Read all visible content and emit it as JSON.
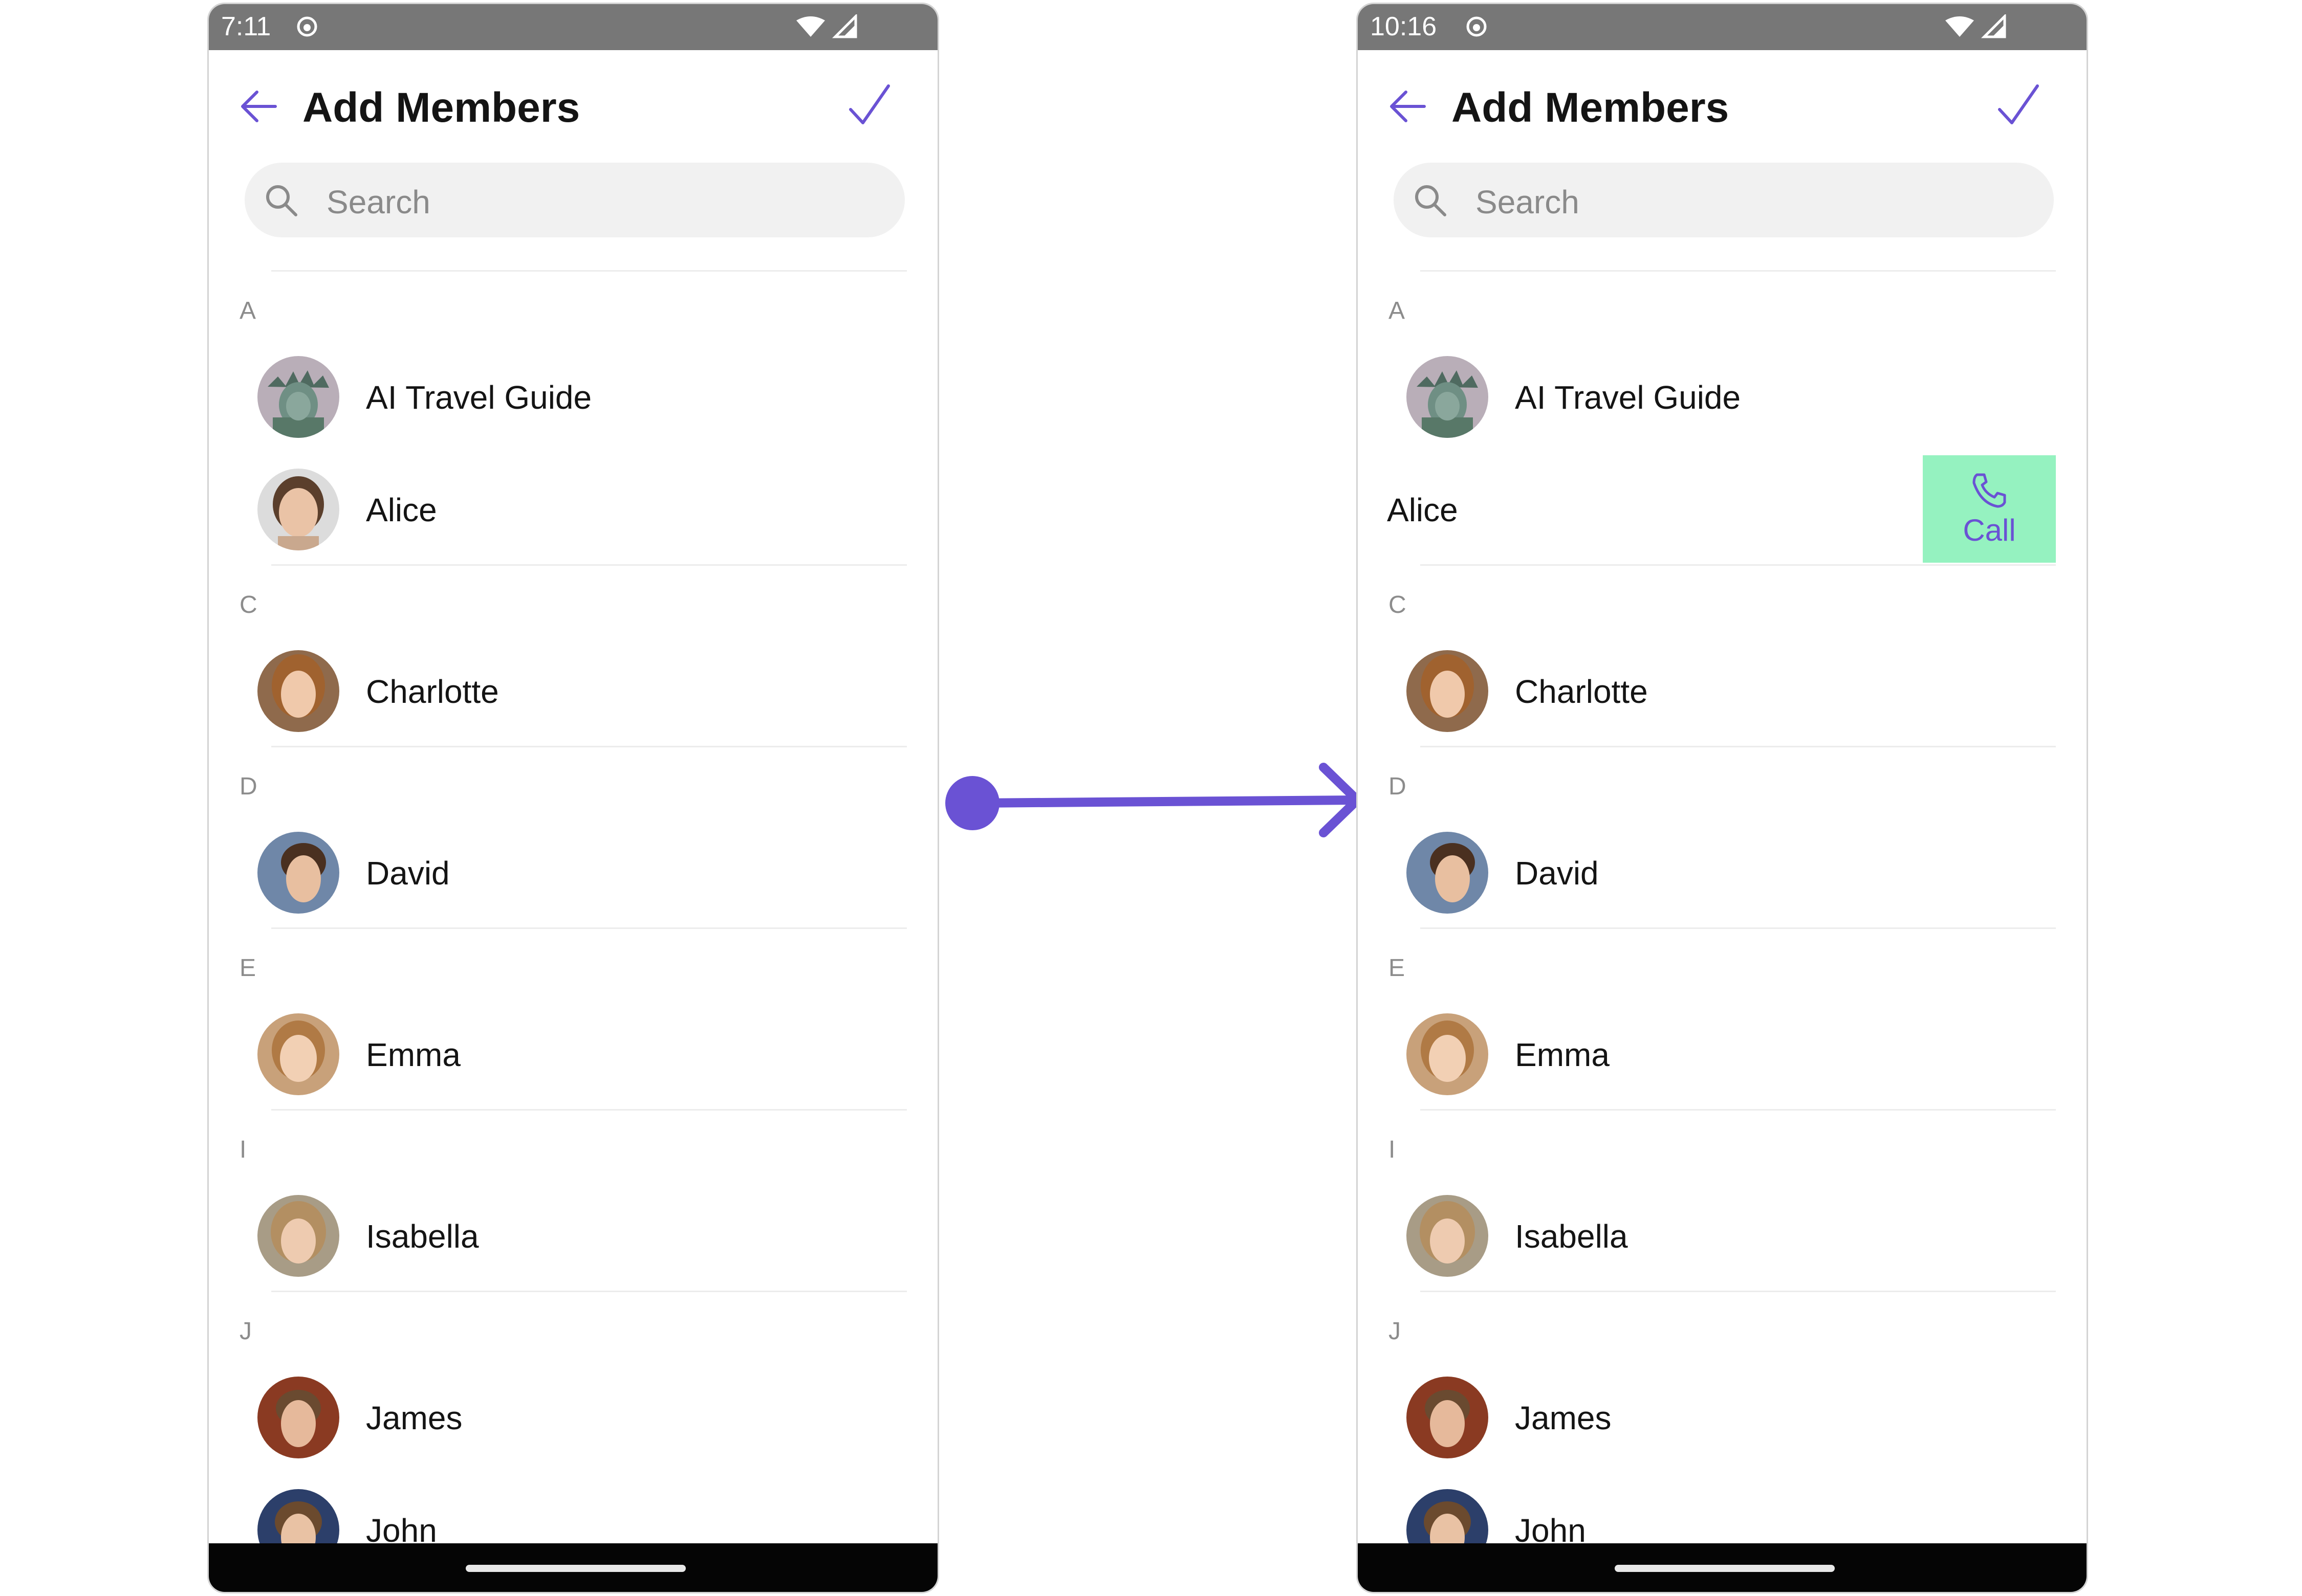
{
  "colors": {
    "accent": "#6a52d4",
    "status_bar": "#777777",
    "call_action_bg": "#95f2c0",
    "nav_bar": "#050505",
    "text_primary": "#141414",
    "text_secondary": "#8c8c8c",
    "search_bg": "#f1f1f1"
  },
  "before": {
    "status": {
      "time": "7:11",
      "icons": [
        "app-notification-icon",
        "wifi-icon",
        "signal-icon"
      ]
    },
    "header": {
      "title": "Add Members",
      "back_icon": "arrow-left-icon",
      "confirm_icon": "checkmark-icon"
    },
    "search": {
      "placeholder": "Search",
      "icon": "search-icon"
    },
    "sections": [
      {
        "letter": "A",
        "members": [
          {
            "name": "AI Travel Guide",
            "avatar": "statue-of-liberty-avatar"
          },
          {
            "name": "Alice",
            "avatar": "user-photo-avatar"
          }
        ]
      },
      {
        "letter": "C",
        "members": [
          {
            "name": "Charlotte",
            "avatar": "user-photo-avatar"
          }
        ]
      },
      {
        "letter": "D",
        "members": [
          {
            "name": "David",
            "avatar": "user-photo-avatar"
          }
        ]
      },
      {
        "letter": "E",
        "members": [
          {
            "name": "Emma",
            "avatar": "user-photo-avatar"
          }
        ]
      },
      {
        "letter": "I",
        "members": [
          {
            "name": "Isabella",
            "avatar": "user-photo-avatar"
          }
        ]
      },
      {
        "letter": "J",
        "members": [
          {
            "name": "James",
            "avatar": "user-photo-avatar"
          },
          {
            "name": "John",
            "avatar": "user-photo-avatar"
          }
        ]
      }
    ]
  },
  "after": {
    "status": {
      "time": "10:16",
      "icons": [
        "app-notification-icon",
        "wifi-icon",
        "signal-icon"
      ]
    },
    "header": {
      "title": "Add Members",
      "back_icon": "arrow-left-icon",
      "confirm_icon": "checkmark-icon"
    },
    "search": {
      "placeholder": "Search",
      "icon": "search-icon"
    },
    "swipe_action": {
      "member": "Alice",
      "label": "Call",
      "icon": "phone-icon"
    },
    "sections": [
      {
        "letter": "A",
        "members": [
          {
            "name": "AI Travel Guide",
            "avatar": "statue-of-liberty-avatar"
          },
          {
            "name": "Alice",
            "avatar": "hidden-swiped"
          }
        ]
      },
      {
        "letter": "C",
        "members": [
          {
            "name": "Charlotte",
            "avatar": "user-photo-avatar"
          }
        ]
      },
      {
        "letter": "D",
        "members": [
          {
            "name": "David",
            "avatar": "user-photo-avatar"
          }
        ]
      },
      {
        "letter": "E",
        "members": [
          {
            "name": "Emma",
            "avatar": "user-photo-avatar"
          }
        ]
      },
      {
        "letter": "I",
        "members": [
          {
            "name": "Isabella",
            "avatar": "user-photo-avatar"
          }
        ]
      },
      {
        "letter": "J",
        "members": [
          {
            "name": "James",
            "avatar": "user-photo-avatar"
          },
          {
            "name": "John",
            "avatar": "user-photo-avatar"
          }
        ]
      }
    ]
  }
}
